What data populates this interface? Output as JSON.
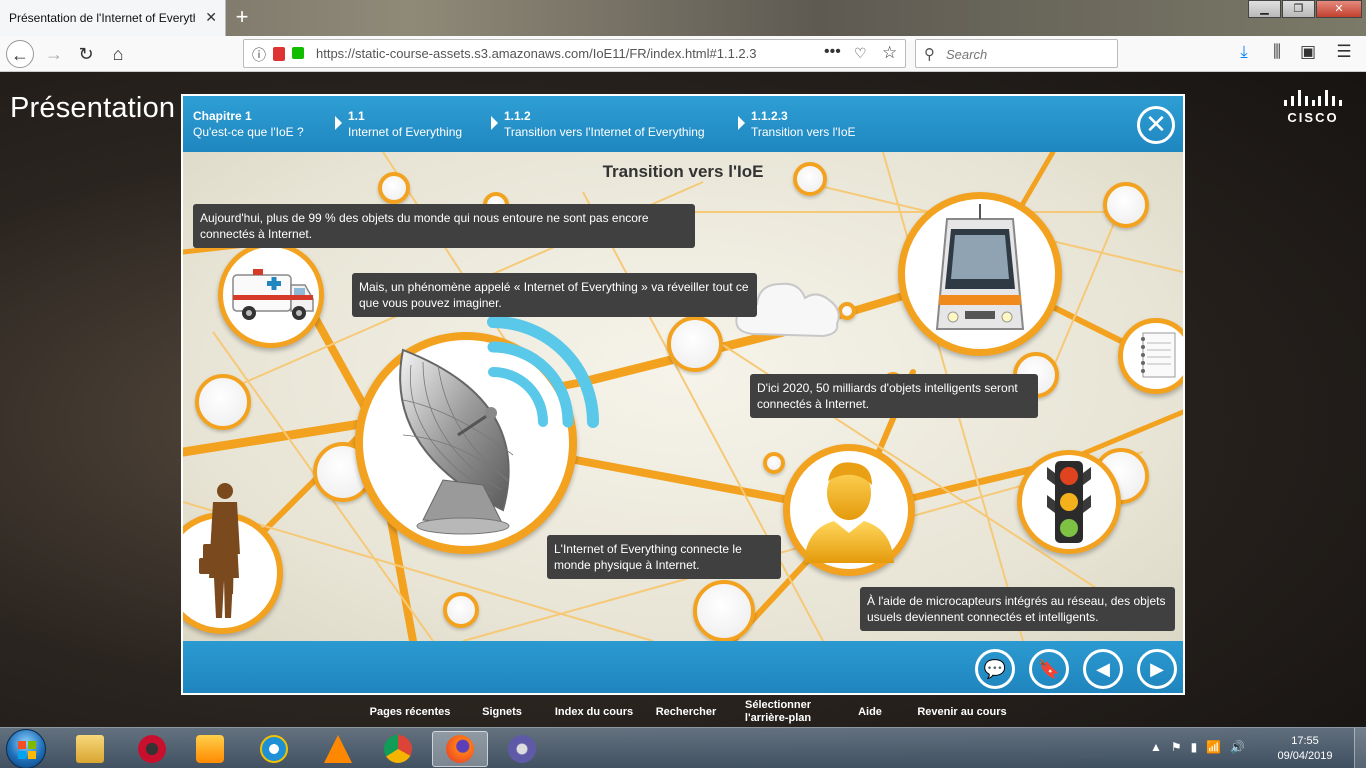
{
  "browser": {
    "tab_title": "Présentation de l'Internet of Everything",
    "tab_close": "✕",
    "new_tab": "+",
    "window_controls": [
      "▁",
      "❐",
      "✕"
    ],
    "url": "https://static-course-assets.s3.amazonaws.com/IoE11/FR/index.html#1.1.2.3",
    "search_placeholder": "Search",
    "nav": {
      "back": "←",
      "forward": "→",
      "reload": "↻",
      "home": "⌂"
    }
  },
  "page": {
    "heading": "Présentation",
    "logo_text": "CISCO"
  },
  "course": {
    "breadcrumbs": [
      {
        "num": "Chapitre 1",
        "label": "Qu'est-ce que l'IoE ?"
      },
      {
        "num": "1.1",
        "label": "Internet of Everything"
      },
      {
        "num": "1.1.2",
        "label": "Transition vers l'Internet of Everything"
      },
      {
        "num": "1.1.2.3",
        "label": "Transition vers l'IoE"
      }
    ],
    "close_glyph": "✕",
    "slide_title": "Transition vers l'IoE",
    "callouts": [
      "Aujourd'hui, plus de 99 % des objets du monde qui nous entoure ne sont pas encore connectés à Internet.",
      "Mais, un phénomène appelé « Internet of Everything » va réveiller tout ce que vous pouvez imaginer.",
      "D'ici 2020, 50 milliards d'objets intelligents seront connectés à Internet.",
      "L'Internet of Everything connecte le monde physique à Internet.",
      "À l'aide de microcapteurs intégrés au réseau, des objets usuels deviennent connectés et intelligents."
    ],
    "controls": {
      "comment": "💬",
      "bookmark": "🔖",
      "prev": "◀",
      "next": "▶"
    }
  },
  "course_menu": [
    "Pages récentes",
    "Signets",
    "Index du cours",
    "Rechercher",
    "Sélectionner l'arrière-plan",
    "Aide",
    "Revenir au cours"
  ],
  "taskbar": {
    "time": "17:55",
    "date": "09/04/2019",
    "tray_icons": [
      "▲",
      "⚑",
      "▮",
      "📶",
      "🔊"
    ]
  },
  "colors": {
    "accent_blue": "#1f86bf",
    "network_orange": "#f3a21f",
    "callout_bg": "#404040"
  }
}
